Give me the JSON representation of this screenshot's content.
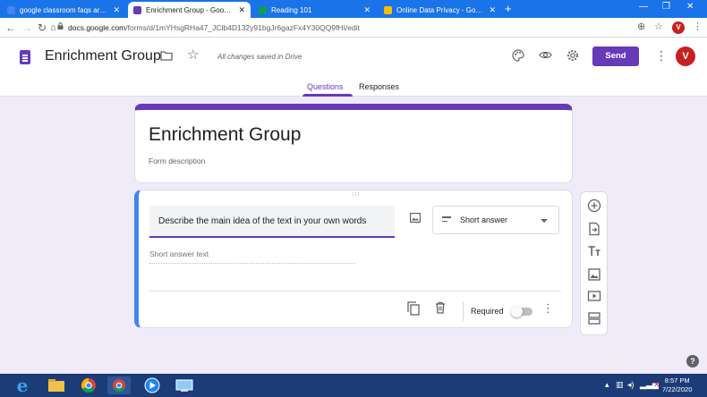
{
  "browser": {
    "tabs": [
      {
        "title": "google classroom faqs article.do",
        "favicon_color": "#4285f4"
      },
      {
        "title": "Enrichment Group - Google Form",
        "favicon_color": "#673ab7"
      },
      {
        "title": "Reading 101",
        "favicon_color": "#0f9d58"
      },
      {
        "title": "Online Data Privacy - Google Sli",
        "favicon_color": "#1a73e8"
      }
    ],
    "active_tab": 1,
    "new_tab_label": "+",
    "url_host": "docs.google.com",
    "url_path": "/forms/d/1mYHsgRHa47_JClb4D132y91bgJr6gazFx4Y30QQ9fHI/edit",
    "profile_initial": "V"
  },
  "header": {
    "title": "Enrichment Group",
    "save_status": "All changes saved in Drive",
    "send_label": "Send",
    "avatar_initial": "V",
    "tabs": [
      {
        "label": "Questions",
        "active": true
      },
      {
        "label": "Responses",
        "active": false
      }
    ]
  },
  "form": {
    "title": "Enrichment Group",
    "description_placeholder": "Form description"
  },
  "question": {
    "text": "Describe the main idea of the text in your own words",
    "type": "Short answer",
    "answer_placeholder": "Short answer text",
    "required_label": "Required",
    "required": false
  },
  "toolbar_icons": [
    "add-question-icon",
    "import-questions-icon",
    "add-title-icon",
    "add-image-icon",
    "add-video-icon",
    "add-section-icon"
  ],
  "taskbar": {
    "time": "8:57 PM",
    "date": "7/22/2020"
  },
  "colors": {
    "accent": "#673ab7",
    "focus_border": "#4285f4",
    "background": "#f0ebf8"
  }
}
